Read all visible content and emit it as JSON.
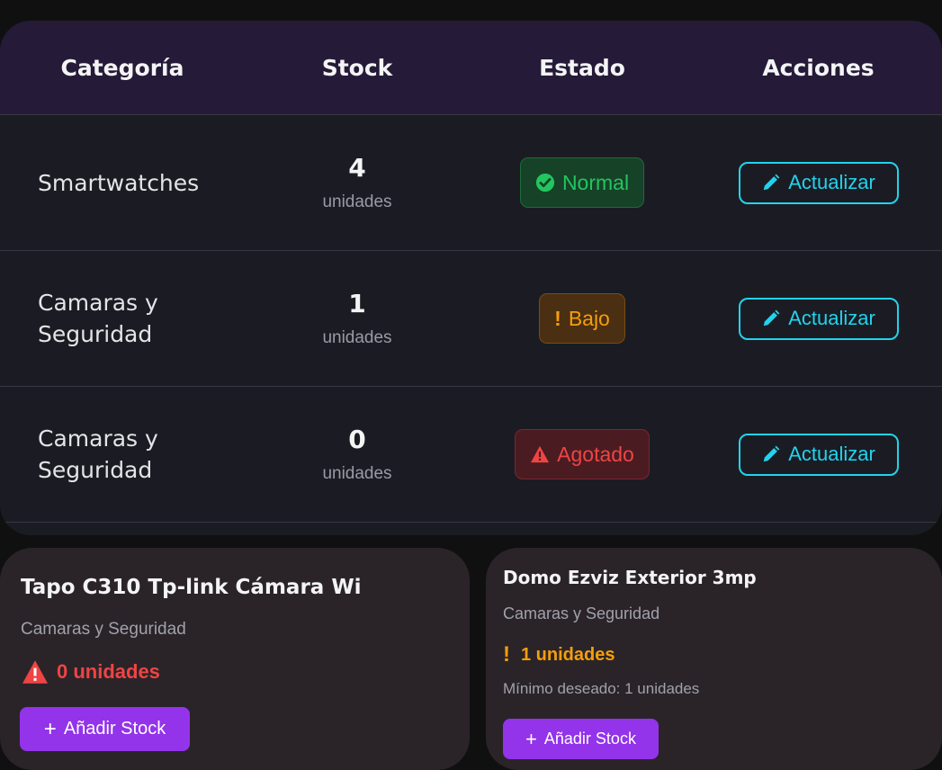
{
  "table": {
    "headers": [
      "Categoría",
      "Stock",
      "Estado",
      "Acciones"
    ],
    "rows": [
      {
        "category": "Smartwatches",
        "stock": "4",
        "unit": "unidades",
        "status": "Normal",
        "status_icon": "check-circle-icon",
        "action": "Actualizar"
      },
      {
        "category_line1": "Camaras y",
        "category_line2": "Seguridad",
        "stock": "1",
        "unit": "unidades",
        "status_symbol": "!",
        "status": "Bajo",
        "action": "Actualizar"
      },
      {
        "category_line1": "Camaras y",
        "category_line2": "Seguridad",
        "stock": "0",
        "unit": "unidades",
        "status": "Agotado",
        "status_icon": "warning-triangle-icon",
        "action": "Actualizar"
      }
    ]
  },
  "cards": [
    {
      "title": "Tapo C310 Tp-link Cámara Wi",
      "category": "Camaras y Seguridad",
      "quantity": "0 unidades",
      "icon": "warning-triangle-icon",
      "button": "Añadir Stock",
      "button_symbol": "+"
    },
    {
      "title": "Domo Ezviz Exterior 3mp",
      "category": "Camaras y Seguridad",
      "quantity_symbol": "!",
      "quantity": "1 unidades",
      "minimum": "Mínimo deseado: 1 unidades",
      "button": "Añadir Stock",
      "button_symbol": "+"
    }
  ],
  "colors": {
    "normal": "#22c55e",
    "low": "#f59e0b",
    "out": "#ef4444",
    "action": "#22d3ee",
    "primary_button": "#9333ea"
  }
}
